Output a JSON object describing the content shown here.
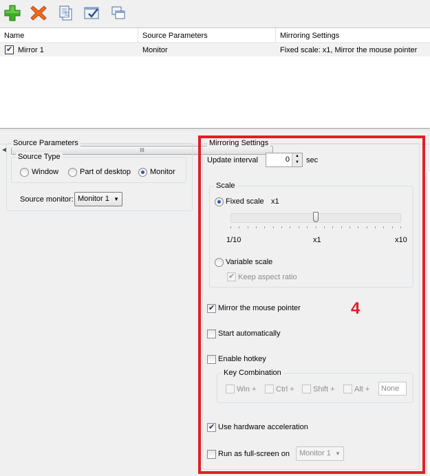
{
  "toolbar": {
    "buttons": [
      "add-icon",
      "delete-icon",
      "copy-icon",
      "edit-check-icon",
      "window-icon"
    ]
  },
  "list": {
    "columns": [
      "Name",
      "Source Parameters",
      "Mirroring Settings"
    ],
    "rows": [
      {
        "name": "Mirror 1",
        "source": "Monitor",
        "settings": "Fixed scale: x1, Mirror the mouse pointer",
        "checked": true
      }
    ],
    "scroll_grip": "III"
  },
  "source": {
    "title": "Source Parameters",
    "type_title": "Source Type",
    "options": [
      "Window",
      "Part of desktop",
      "Monitor"
    ],
    "selected": "Monitor",
    "monitor_label": "Source monitor:",
    "monitor_value": "Monitor 1"
  },
  "mirroring": {
    "title": "Mirroring Settings",
    "update_label": "Update interval",
    "update_value": "0",
    "update_unit": "sec",
    "scale_title": "Scale",
    "fixed_label": "Fixed scale",
    "fixed_value": "x1",
    "slider_min": "1/10",
    "slider_mid": "x1",
    "slider_max": "x10",
    "slider_position": 0.5,
    "variable_label": "Variable scale",
    "aspect_label": "Keep aspect ratio",
    "mouse_label": "Mirror the mouse pointer",
    "start_label": "Start automatically",
    "hotkey_label": "Enable hotkey",
    "keycombo_title": "Key Combination",
    "keys": [
      "Win +",
      "Ctrl +",
      "Shift +",
      "Alt +"
    ],
    "key_value": "None",
    "hw_label": "Use hardware acceleration",
    "fullscreen_label": "Run as full-screen on",
    "fullscreen_value": "Monitor 1"
  },
  "annotation": {
    "label": "4",
    "color": "#e01f2a"
  }
}
